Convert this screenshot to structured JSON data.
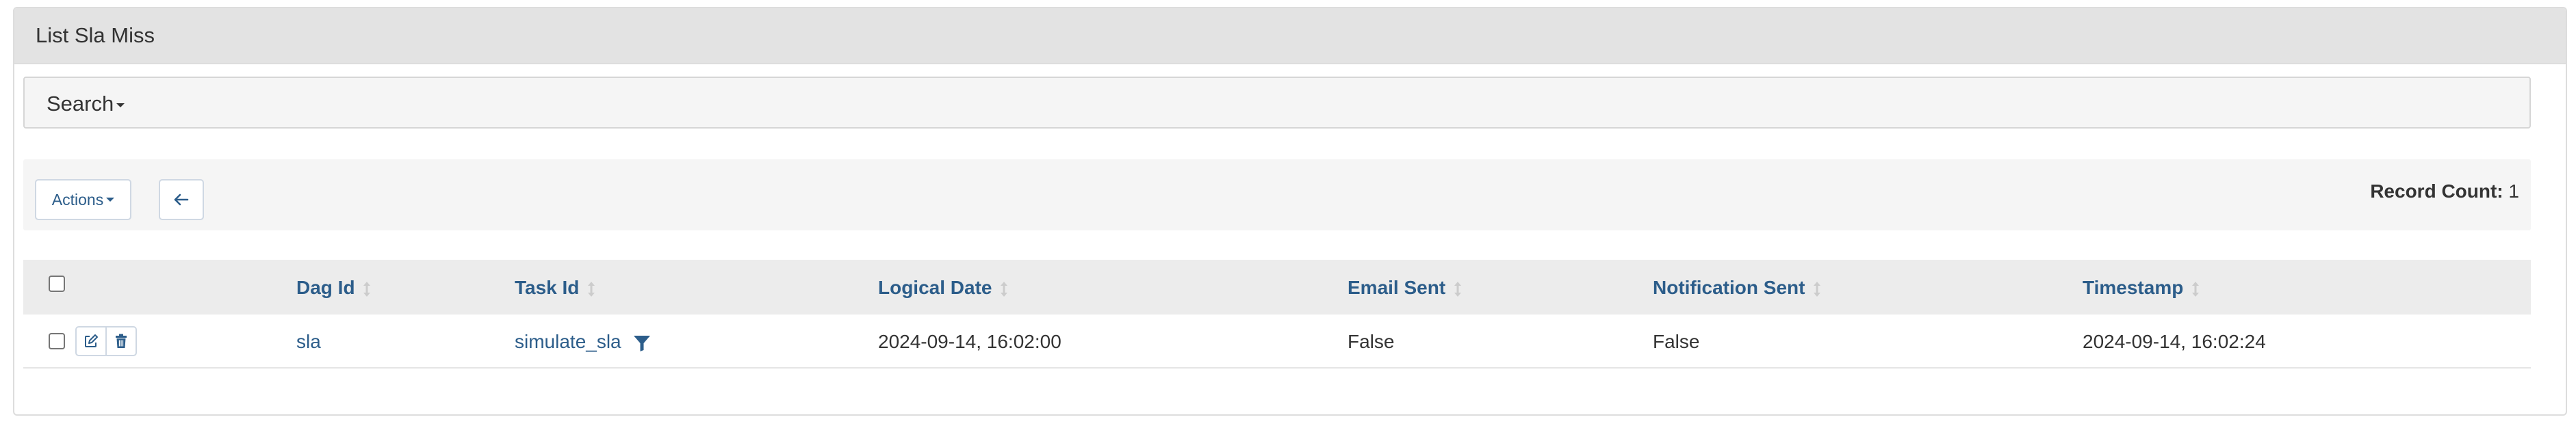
{
  "panel": {
    "title": "List Sla Miss"
  },
  "search": {
    "label": "Search"
  },
  "toolbar": {
    "actions_label": "Actions",
    "record_count_label": "Record Count:",
    "record_count_value": "1"
  },
  "table": {
    "columns": [
      "Dag Id",
      "Task Id",
      "Logical Date",
      "Email Sent",
      "Notification Sent",
      "Timestamp"
    ],
    "rows": [
      {
        "dag_id": "sla",
        "task_id": "simulate_sla",
        "logical_date": "2024-09-14, 16:02:00",
        "email_sent": "False",
        "notification_sent": "False",
        "timestamp": "2024-09-14, 16:02:24"
      }
    ]
  },
  "icons": {
    "back": "arrow-left-icon",
    "edit": "edit-icon",
    "delete": "trash-icon",
    "filter": "filter-icon",
    "sort": "sort-icon"
  },
  "colors": {
    "link": "#2c5d8a",
    "heading_bg": "#e3e3e3",
    "toolbar_bg": "#f5f5f5"
  }
}
